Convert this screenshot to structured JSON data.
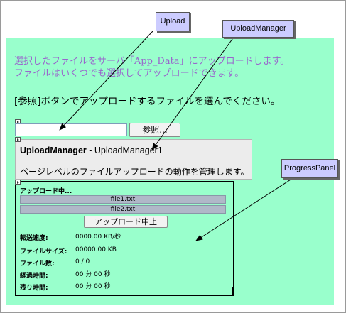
{
  "intro": {
    "line1_before": "選択したファイルをサーバ「",
    "line1_appdata": "App_Data",
    "line1_after": "」にアップロードします。",
    "line2": "ファイルはいくつでも選択してアップロードできます。"
  },
  "instruction": "[参照]ボタンでアップロードするファイルを選んでください。",
  "upload": {
    "input_value": "",
    "browse_label": "参照..."
  },
  "upload_manager": {
    "type_name": "UploadManager",
    "separator": " - ",
    "instance_name": "UploadManager1",
    "description": "ページレベルのファイルアップロードの動作を管理します。"
  },
  "progress_panel": {
    "status": "アップロード中...",
    "files": [
      "file1.txt",
      "file2.txt"
    ],
    "cancel_label": "アップロード中止",
    "stats": [
      {
        "label": "転送速度:",
        "value": "0000.00 KB/秒"
      },
      {
        "label": "ファイルサイズ:",
        "value": "00000.00 KB"
      },
      {
        "label": "ファイル数:",
        "value": "0 / 0"
      },
      {
        "label": "経過時間:",
        "value": "00 分 00 秒"
      },
      {
        "label": "残り時間:",
        "value": "00 分 00 秒"
      }
    ]
  },
  "callouts": {
    "upload": "Upload",
    "upload_manager": "UploadManager",
    "progress_panel": "ProgressPanel"
  },
  "colors": {
    "designer_bg": "#99ffcc",
    "intro_text": "#9966cc",
    "callout_bg": "#ccccff"
  }
}
